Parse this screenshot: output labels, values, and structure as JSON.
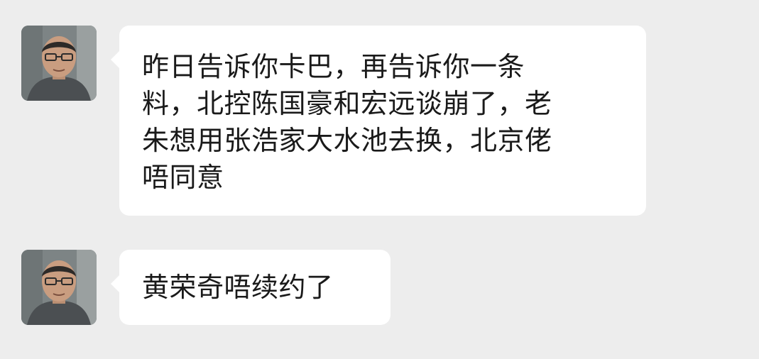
{
  "theme": {
    "background": "#ededed",
    "bubble_background": "#ffffff",
    "text_color": "#1a1a1a"
  },
  "messages": [
    {
      "sender_avatar_icon": "person-avatar-icon",
      "lines": [
        "昨日告诉你卡巴，再告诉你一条",
        "料，北控陈国豪和宏远谈崩了，老",
        "朱想用张浩家大水池去换，北京佬",
        "唔同意"
      ]
    },
    {
      "sender_avatar_icon": "person-avatar-icon",
      "lines": [
        "黄荣奇唔续约了"
      ]
    }
  ]
}
